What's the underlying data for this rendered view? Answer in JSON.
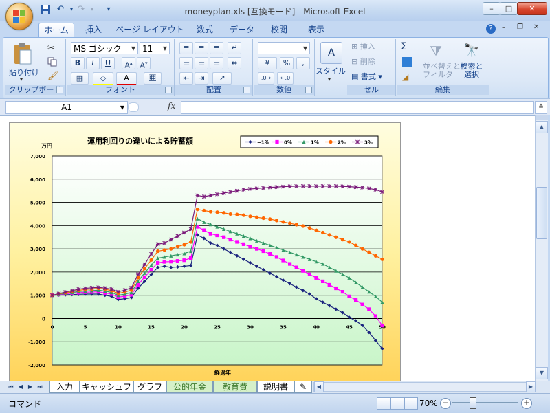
{
  "window": {
    "title": "moneyplan.xls  [互換モード] - Microsoft Excel",
    "min_label": "–",
    "max_label": "□",
    "close_label": "✕"
  },
  "ribbon": {
    "tabs": [
      "ホーム",
      "挿入",
      "ページ レイアウト",
      "数式",
      "データ",
      "校閲",
      "表示"
    ],
    "clipboard": {
      "paste": "貼り付け",
      "label": "クリップボード"
    },
    "font": {
      "name": "MS ゴシック",
      "size": "11",
      "label": "フォント",
      "bold": "B",
      "italic": "I",
      "underline": "U"
    },
    "alignment": {
      "label": "配置"
    },
    "number": {
      "label": "数値",
      "percent": "%",
      "comma": ","
    },
    "style": {
      "label": "スタイル"
    },
    "cells": {
      "insert": "挿入",
      "delete": "削除",
      "format": "書式",
      "label": "セル"
    },
    "editing": {
      "sort": "並べ替えと\nフィルタ",
      "find": "検索と\n選択",
      "label": "編集",
      "sigma": "Σ"
    }
  },
  "formula_bar": {
    "cell_ref": "A1",
    "fx": "fx",
    "value": ""
  },
  "sheet_tabs": [
    "入力",
    "キャッシュフロー",
    "グラフ",
    "公的年金",
    "教育費",
    "説明書"
  ],
  "active_sheet": "グラフ",
  "status": {
    "mode": "コマンド",
    "zoom": "70%"
  },
  "colors": {
    "accent": "#15428b",
    "ribbon_bg": "#dce8f7"
  },
  "chart_data": {
    "type": "line",
    "title": "運用利回りの違いによる貯蓄額",
    "xlabel": "経過年",
    "ylabel": "万円",
    "xlim": [
      0,
      50
    ],
    "ylim": [
      -2000,
      7000
    ],
    "xticks": [
      0,
      5,
      10,
      15,
      20,
      25,
      30,
      35,
      40,
      45,
      50
    ],
    "yticks": [
      -2000,
      -1000,
      0,
      1000,
      2000,
      3000,
      4000,
      5000,
      6000,
      7000
    ],
    "ytick_labels": [
      "-2,000",
      "-1,000",
      "0",
      "1,000",
      "2,000",
      "3,000",
      "4,000",
      "5,000",
      "6,000",
      "7,000"
    ],
    "grid": "horizontal",
    "legend_position": "top-right",
    "x": [
      0,
      1,
      2,
      3,
      4,
      5,
      6,
      7,
      8,
      9,
      10,
      11,
      12,
      13,
      14,
      15,
      16,
      17,
      18,
      19,
      20,
      21,
      22,
      23,
      24,
      25,
      26,
      27,
      28,
      29,
      30,
      31,
      32,
      33,
      34,
      35,
      36,
      37,
      38,
      39,
      40,
      41,
      42,
      43,
      44,
      45,
      46,
      47,
      48,
      49,
      50
    ],
    "series": [
      {
        "name": "−1％",
        "color": "#1a237e",
        "marker": "diamond",
        "values": [
          1000,
          1010,
          1020,
          1030,
          1040,
          1050,
          1050,
          1050,
          1000,
          950,
          820,
          850,
          900,
          1300,
          1600,
          1900,
          2200,
          2250,
          2200,
          2220,
          2250,
          2280,
          3600,
          3450,
          3250,
          3150,
          3000,
          2850,
          2700,
          2550,
          2400,
          2250,
          2100,
          1950,
          1800,
          1650,
          1500,
          1350,
          1200,
          1050,
          850,
          700,
          550,
          400,
          250,
          50,
          -100,
          -300,
          -600,
          -950,
          -1300
        ]
      },
      {
        "name": "0％",
        "color": "#ff00ff",
        "marker": "square",
        "values": [
          1000,
          1030,
          1060,
          1090,
          1110,
          1130,
          1140,
          1150,
          1100,
          1050,
          920,
          960,
          1020,
          1450,
          1780,
          2100,
          2400,
          2440,
          2450,
          2480,
          2510,
          2600,
          3950,
          3800,
          3650,
          3580,
          3500,
          3400,
          3300,
          3200,
          3100,
          3000,
          2900,
          2780,
          2650,
          2500,
          2350,
          2200,
          2050,
          1900,
          1750,
          1600,
          1450,
          1300,
          1150,
          950,
          800,
          600,
          400,
          100,
          -300
        ]
      },
      {
        "name": "1％",
        "color": "#339966",
        "marker": "triangle",
        "values": [
          1000,
          1040,
          1080,
          1120,
          1160,
          1180,
          1200,
          1220,
          1180,
          1120,
          1000,
          1050,
          1120,
          1600,
          1960,
          2300,
          2600,
          2650,
          2700,
          2750,
          2800,
          2900,
          4300,
          4150,
          4050,
          3950,
          3850,
          3750,
          3650,
          3550,
          3450,
          3350,
          3250,
          3150,
          3050,
          2950,
          2850,
          2750,
          2650,
          2550,
          2450,
          2350,
          2200,
          2050,
          1900,
          1750,
          1550,
          1350,
          1150,
          950,
          700
        ]
      },
      {
        "name": "2％",
        "color": "#ff6600",
        "marker": "circle",
        "values": [
          1000,
          1060,
          1110,
          1160,
          1210,
          1250,
          1270,
          1300,
          1260,
          1200,
          1080,
          1140,
          1220,
          1760,
          2150,
          2520,
          2900,
          2950,
          3000,
          3100,
          3180,
          3300,
          4700,
          4650,
          4600,
          4580,
          4550,
          4500,
          4480,
          4450,
          4400,
          4360,
          4320,
          4280,
          4220,
          4160,
          4100,
          4040,
          3980,
          3900,
          3800,
          3700,
          3600,
          3500,
          3400,
          3300,
          3150,
          3000,
          2850,
          2700,
          2550
        ]
      },
      {
        "name": "3％",
        "color": "#7a1a7a",
        "marker": "star",
        "values": [
          1000,
          1070,
          1140,
          1200,
          1260,
          1300,
          1320,
          1340,
          1310,
          1260,
          1150,
          1220,
          1320,
          1900,
          2330,
          2780,
          3200,
          3250,
          3400,
          3550,
          3700,
          3850,
          5300,
          5250,
          5300,
          5350,
          5400,
          5450,
          5500,
          5550,
          5580,
          5600,
          5620,
          5650,
          5660,
          5680,
          5690,
          5700,
          5700,
          5700,
          5700,
          5700,
          5700,
          5700,
          5690,
          5680,
          5660,
          5640,
          5600,
          5550,
          5450
        ]
      }
    ]
  }
}
